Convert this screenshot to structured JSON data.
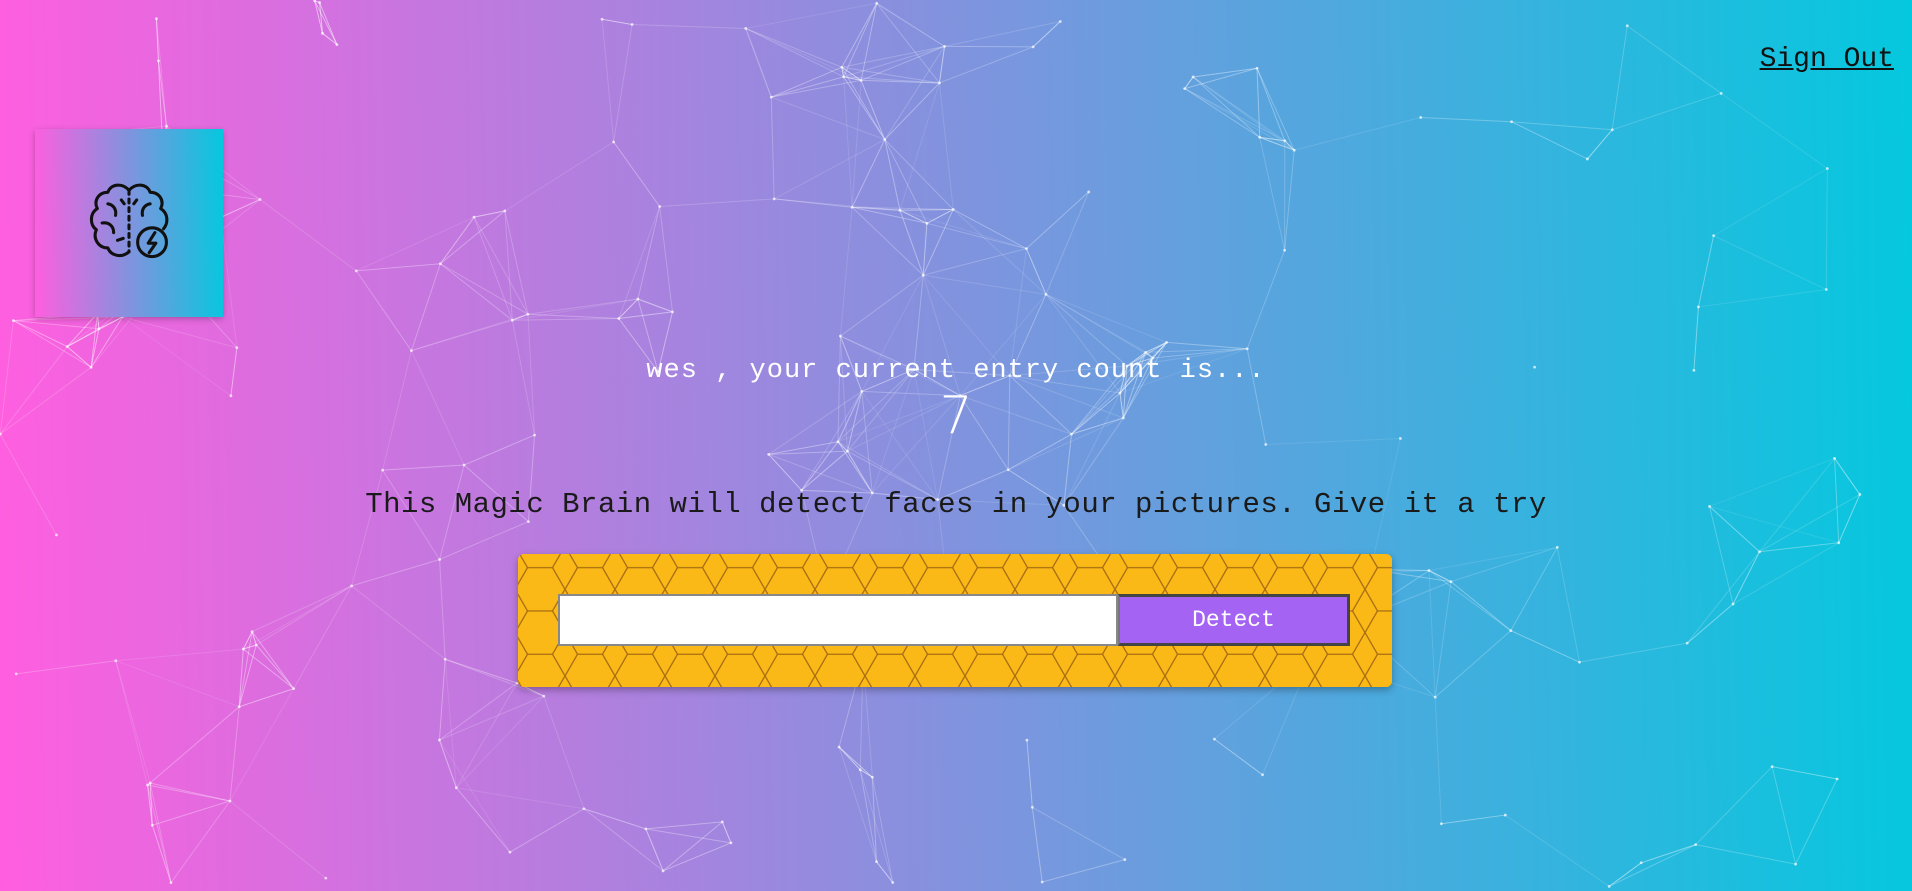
{
  "nav": {
    "sign_out": "Sign Out"
  },
  "logo": {
    "icon": "brain-icon"
  },
  "rank": {
    "message": "wes , your current entry count is...",
    "count": "7"
  },
  "intro": "This Magic Brain will detect faces in your pictures. Give it a try",
  "form": {
    "input_value": "",
    "input_placeholder": "",
    "detect_label": "Detect"
  },
  "colors": {
    "gradient_start": "#ff5edf",
    "gradient_end": "#04c8de",
    "panel": "#fbb917",
    "button": "#a463f2"
  }
}
